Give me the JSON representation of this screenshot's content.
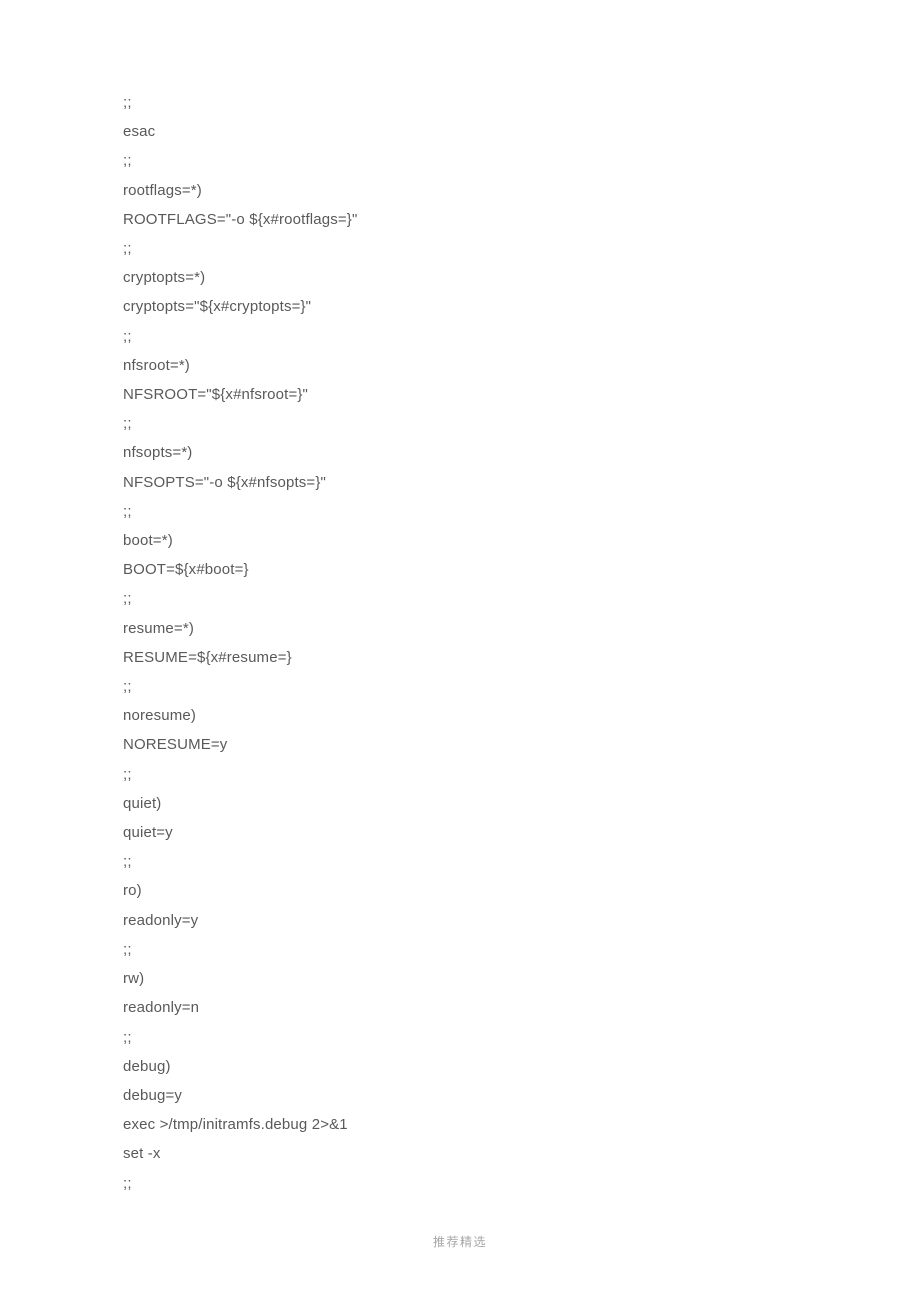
{
  "lines": [
    ";;",
    "esac",
    ";;",
    "rootflags=*)",
    "ROOTFLAGS=\"-o ${x#rootflags=}\"",
    ";;",
    "cryptopts=*)",
    "cryptopts=\"${x#cryptopts=}\"",
    ";;",
    "nfsroot=*)",
    "NFSROOT=\"${x#nfsroot=}\"",
    ";;",
    "nfsopts=*)",
    "NFSOPTS=\"-o ${x#nfsopts=}\"",
    ";;",
    "boot=*)",
    "BOOT=${x#boot=}",
    ";;",
    "resume=*)",
    "RESUME=${x#resume=}",
    ";;",
    "noresume)",
    "NORESUME=y",
    ";;",
    "quiet)",
    "quiet=y",
    ";;",
    "ro)",
    "readonly=y",
    ";;",
    "rw)",
    "readonly=n",
    ";;",
    "debug)",
    "debug=y",
    "exec >/tmp/initramfs.debug 2>&1",
    "set -x",
    ";;"
  ],
  "footer": "推荐精选"
}
